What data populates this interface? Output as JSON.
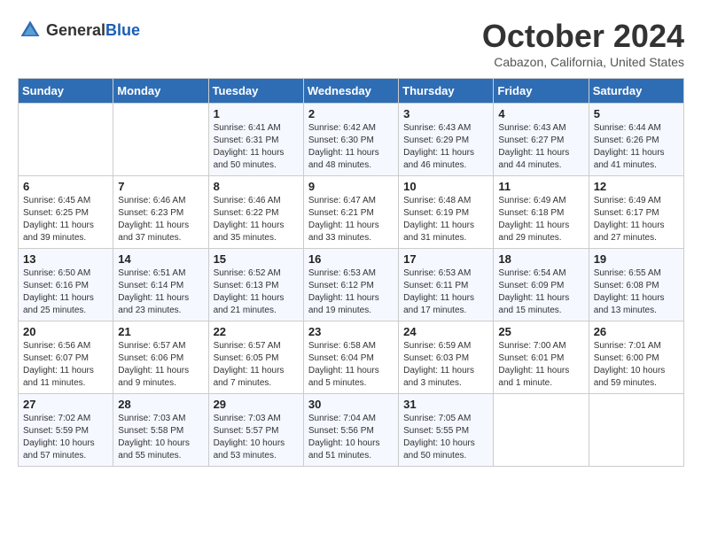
{
  "header": {
    "logo_general": "General",
    "logo_blue": "Blue",
    "month_title": "October 2024",
    "location": "Cabazon, California, United States"
  },
  "days_of_week": [
    "Sunday",
    "Monday",
    "Tuesday",
    "Wednesday",
    "Thursday",
    "Friday",
    "Saturday"
  ],
  "weeks": [
    [
      {
        "day": "",
        "info": ""
      },
      {
        "day": "",
        "info": ""
      },
      {
        "day": "1",
        "info": "Sunrise: 6:41 AM\nSunset: 6:31 PM\nDaylight: 11 hours and 50 minutes."
      },
      {
        "day": "2",
        "info": "Sunrise: 6:42 AM\nSunset: 6:30 PM\nDaylight: 11 hours and 48 minutes."
      },
      {
        "day": "3",
        "info": "Sunrise: 6:43 AM\nSunset: 6:29 PM\nDaylight: 11 hours and 46 minutes."
      },
      {
        "day": "4",
        "info": "Sunrise: 6:43 AM\nSunset: 6:27 PM\nDaylight: 11 hours and 44 minutes."
      },
      {
        "day": "5",
        "info": "Sunrise: 6:44 AM\nSunset: 6:26 PM\nDaylight: 11 hours and 41 minutes."
      }
    ],
    [
      {
        "day": "6",
        "info": "Sunrise: 6:45 AM\nSunset: 6:25 PM\nDaylight: 11 hours and 39 minutes."
      },
      {
        "day": "7",
        "info": "Sunrise: 6:46 AM\nSunset: 6:23 PM\nDaylight: 11 hours and 37 minutes."
      },
      {
        "day": "8",
        "info": "Sunrise: 6:46 AM\nSunset: 6:22 PM\nDaylight: 11 hours and 35 minutes."
      },
      {
        "day": "9",
        "info": "Sunrise: 6:47 AM\nSunset: 6:21 PM\nDaylight: 11 hours and 33 minutes."
      },
      {
        "day": "10",
        "info": "Sunrise: 6:48 AM\nSunset: 6:19 PM\nDaylight: 11 hours and 31 minutes."
      },
      {
        "day": "11",
        "info": "Sunrise: 6:49 AM\nSunset: 6:18 PM\nDaylight: 11 hours and 29 minutes."
      },
      {
        "day": "12",
        "info": "Sunrise: 6:49 AM\nSunset: 6:17 PM\nDaylight: 11 hours and 27 minutes."
      }
    ],
    [
      {
        "day": "13",
        "info": "Sunrise: 6:50 AM\nSunset: 6:16 PM\nDaylight: 11 hours and 25 minutes."
      },
      {
        "day": "14",
        "info": "Sunrise: 6:51 AM\nSunset: 6:14 PM\nDaylight: 11 hours and 23 minutes."
      },
      {
        "day": "15",
        "info": "Sunrise: 6:52 AM\nSunset: 6:13 PM\nDaylight: 11 hours and 21 minutes."
      },
      {
        "day": "16",
        "info": "Sunrise: 6:53 AM\nSunset: 6:12 PM\nDaylight: 11 hours and 19 minutes."
      },
      {
        "day": "17",
        "info": "Sunrise: 6:53 AM\nSunset: 6:11 PM\nDaylight: 11 hours and 17 minutes."
      },
      {
        "day": "18",
        "info": "Sunrise: 6:54 AM\nSunset: 6:09 PM\nDaylight: 11 hours and 15 minutes."
      },
      {
        "day": "19",
        "info": "Sunrise: 6:55 AM\nSunset: 6:08 PM\nDaylight: 11 hours and 13 minutes."
      }
    ],
    [
      {
        "day": "20",
        "info": "Sunrise: 6:56 AM\nSunset: 6:07 PM\nDaylight: 11 hours and 11 minutes."
      },
      {
        "day": "21",
        "info": "Sunrise: 6:57 AM\nSunset: 6:06 PM\nDaylight: 11 hours and 9 minutes."
      },
      {
        "day": "22",
        "info": "Sunrise: 6:57 AM\nSunset: 6:05 PM\nDaylight: 11 hours and 7 minutes."
      },
      {
        "day": "23",
        "info": "Sunrise: 6:58 AM\nSunset: 6:04 PM\nDaylight: 11 hours and 5 minutes."
      },
      {
        "day": "24",
        "info": "Sunrise: 6:59 AM\nSunset: 6:03 PM\nDaylight: 11 hours and 3 minutes."
      },
      {
        "day": "25",
        "info": "Sunrise: 7:00 AM\nSunset: 6:01 PM\nDaylight: 11 hours and 1 minute."
      },
      {
        "day": "26",
        "info": "Sunrise: 7:01 AM\nSunset: 6:00 PM\nDaylight: 10 hours and 59 minutes."
      }
    ],
    [
      {
        "day": "27",
        "info": "Sunrise: 7:02 AM\nSunset: 5:59 PM\nDaylight: 10 hours and 57 minutes."
      },
      {
        "day": "28",
        "info": "Sunrise: 7:03 AM\nSunset: 5:58 PM\nDaylight: 10 hours and 55 minutes."
      },
      {
        "day": "29",
        "info": "Sunrise: 7:03 AM\nSunset: 5:57 PM\nDaylight: 10 hours and 53 minutes."
      },
      {
        "day": "30",
        "info": "Sunrise: 7:04 AM\nSunset: 5:56 PM\nDaylight: 10 hours and 51 minutes."
      },
      {
        "day": "31",
        "info": "Sunrise: 7:05 AM\nSunset: 5:55 PM\nDaylight: 10 hours and 50 minutes."
      },
      {
        "day": "",
        "info": ""
      },
      {
        "day": "",
        "info": ""
      }
    ]
  ]
}
